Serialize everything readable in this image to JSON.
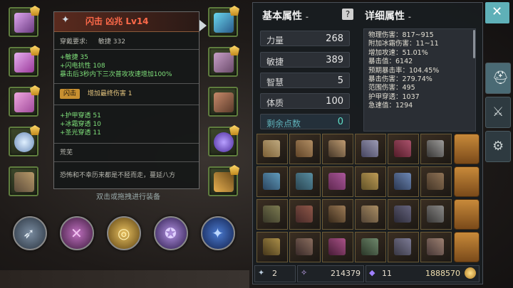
{
  "tooltip": {
    "title": "闪击 凶兆 Lv14",
    "requirement_label": "穿戴要求:",
    "requirement_value": "敏捷 332",
    "base_stats": [
      "+敏捷 35",
      "+闪电抗性 108",
      "暴击后3秒内下三次普攻攻速增加100%"
    ],
    "skill_tag": "闪击",
    "skill_effect": "增加最终伤害 1",
    "extra_stats": [
      "+护甲穿透 51",
      "+冰霜穿透 10",
      "+圣光穿透 11"
    ],
    "flavor_title": "荒芜",
    "flavor_text": "恐怖和不幸历来都是不胫而走，蔓延八方"
  },
  "hint_text": "双击或拖拽进行装备",
  "basic_attrs": {
    "header": "基本属性",
    "stats": [
      {
        "label": "力量",
        "value": "268"
      },
      {
        "label": "敏捷",
        "value": "389"
      },
      {
        "label": "智慧",
        "value": "5"
      },
      {
        "label": "体质",
        "value": "100"
      }
    ],
    "remaining_label": "剩余点数",
    "remaining_value": "0"
  },
  "detail_attrs": {
    "header": "详细属性",
    "lines": [
      "物理伤害：817~915",
      "附加冰霜伤害：11~11",
      "增加攻速：51.01%",
      "暴击值：6142",
      "预期暴击率：104.45%",
      "暴击伤害：279.74%",
      "范围伤害：495",
      "护甲穿透：1037",
      "急速值：1294"
    ]
  },
  "footer": {
    "item1_count": "2",
    "item2_count": "214379",
    "item3_count": "11",
    "gold": "1888570"
  },
  "colors": {
    "accent_teal": "#5fb0b8",
    "tooltip_title": "#ff6a4a",
    "green_stat": "#7fe07a"
  },
  "icons": [
    "close-icon",
    "helmet-icon",
    "swords-icon",
    "gear-wheel-icon",
    "question-icon"
  ]
}
